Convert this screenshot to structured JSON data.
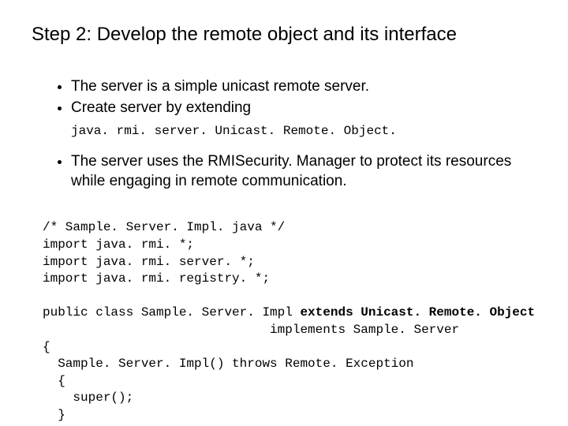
{
  "title": "Step 2: Develop the remote object and its interface",
  "bullets_a": [
    "The server is a simple unicast remote server.",
    "Create server by extending"
  ],
  "code_under_bullet": "java. rmi. server. Unicast. Remote. Object.",
  "bullets_b": [
    "The server uses the RMISecurity. Manager to protect its resources while engaging in remote communication."
  ],
  "code": {
    "l1": "/* Sample. Server. Impl. java */",
    "l2": "import java. rmi. *;",
    "l3": "import java. rmi. server. *;",
    "l4": "import java. rmi. registry. *;",
    "l5a": "public class Sample. Server. Impl ",
    "l5b": "extends Unicast. Remote. Object",
    "l6": "                              implements Sample. Server",
    "l7": "{",
    "l8": "  Sample. Server. Impl() throws Remote. Exception",
    "l9": "  {",
    "l10": "    super();",
    "l11": "  }"
  }
}
